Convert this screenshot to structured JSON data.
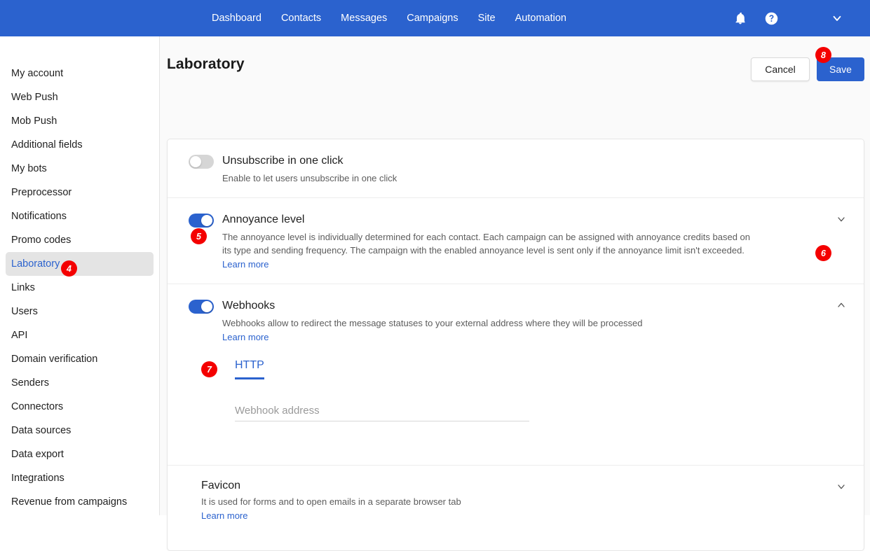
{
  "topnav": {
    "links": [
      {
        "label": "Dashboard"
      },
      {
        "label": "Contacts"
      },
      {
        "label": "Messages"
      },
      {
        "label": "Campaigns"
      },
      {
        "label": "Site"
      },
      {
        "label": "Automation"
      }
    ],
    "icons": {
      "notifications": "bell-icon",
      "help": "help-circle-icon",
      "account_menu": "chevron-down-icon"
    },
    "brand_color": "#2b62ce"
  },
  "sidebar": {
    "items": [
      {
        "label": "My account",
        "active": false
      },
      {
        "label": "Web Push",
        "active": false
      },
      {
        "label": "Mob Push",
        "active": false
      },
      {
        "label": "Additional fields",
        "active": false
      },
      {
        "label": "My bots",
        "active": false
      },
      {
        "label": "Preprocessor",
        "active": false
      },
      {
        "label": "Notifications",
        "active": false
      },
      {
        "label": "Promo codes",
        "active": false
      },
      {
        "label": "Laboratory",
        "active": true
      },
      {
        "label": "Links",
        "active": false
      },
      {
        "label": "Users",
        "active": false
      },
      {
        "label": "API",
        "active": false
      },
      {
        "label": "Domain verification",
        "active": false
      },
      {
        "label": "Senders",
        "active": false
      },
      {
        "label": "Connectors",
        "active": false
      },
      {
        "label": "Data sources",
        "active": false
      },
      {
        "label": "Data export",
        "active": false
      },
      {
        "label": "Integrations",
        "active": false
      },
      {
        "label": "Revenue from campaigns",
        "active": false
      }
    ]
  },
  "header": {
    "title": "Laboratory",
    "cancel_label": "Cancel",
    "save_label": "Save"
  },
  "settings": {
    "unsubscribe": {
      "title": "Unsubscribe in one click",
      "description": "Enable to let users unsubscribe in one click",
      "toggle_state": "off"
    },
    "annoyance": {
      "title": "Annoyance level",
      "description": "The annoyance level is individually determined for each contact. Each campaign can be assigned with annoyance credits based on its type and sending frequency. The campaign with the enabled annoyance level is sent only if the annoyance limit isn't exceeded.",
      "learn_more": "Learn more",
      "toggle_state": "on",
      "chevron": "chevron-down-icon"
    },
    "webhooks": {
      "title": "Webhooks",
      "description": "Webhooks allow to redirect the message statuses to your external address where they will be processed",
      "learn_more": "Learn more",
      "toggle_state": "on",
      "chevron": "chevron-up-icon",
      "tab_label": "HTTP",
      "address_placeholder": "Webhook address",
      "address_value": ""
    },
    "favicon": {
      "title": "Favicon",
      "description": "It is used for forms and to open emails in a separate browser tab",
      "learn_more": "Learn more",
      "chevron": "chevron-down-icon"
    }
  },
  "badges": {
    "b4": "4",
    "b5": "5",
    "b6": "6",
    "b7": "7",
    "b8": "8",
    "color": "#f40000"
  }
}
